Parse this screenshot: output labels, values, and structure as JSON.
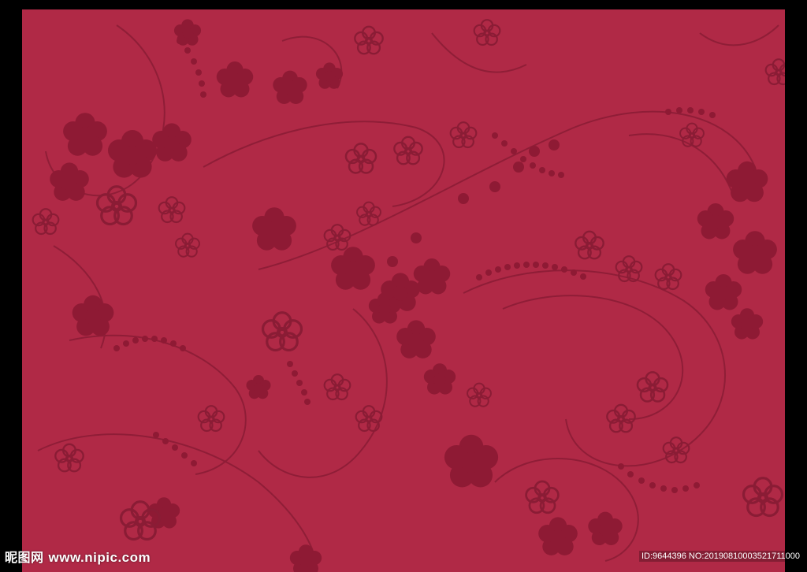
{
  "colors": {
    "background": "#000000",
    "fabric": "#b02946",
    "motif_dark": "#8e1a34",
    "motif_line": "#8a1c35",
    "watermark_text": "#ffffff"
  },
  "watermark": {
    "brand": "昵图网",
    "url": "www.nipic.com",
    "id_text": "ID:9644396 NO:20190810003521711000"
  }
}
